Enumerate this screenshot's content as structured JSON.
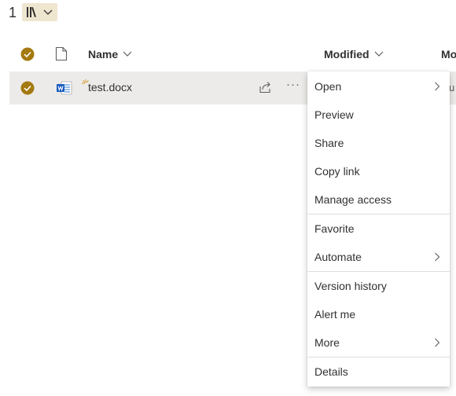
{
  "breadcrumb": {
    "count": "1"
  },
  "icons": {
    "library": "library-icon",
    "dropdown": "chevron-down-icon",
    "check": "check-circle-icon",
    "file": "file-type-icon",
    "word": "word-doc-icon",
    "new": "new-item-icon",
    "share": "share-icon",
    "more": "more-ellipsis-icon",
    "submenu": "chevron-right-icon"
  },
  "colors": {
    "accent": "#a4790f",
    "row_selected": "#edebe9",
    "library_bg": "#efe6cf"
  },
  "columns": {
    "name": "Name",
    "modified": "Modified",
    "modified_by": "Mo"
  },
  "file_row": {
    "name": "test.docx",
    "more": "···",
    "clipped_text": "u"
  },
  "context_menu": {
    "items": [
      {
        "label": "Open",
        "submenu": true
      },
      {
        "label": "Preview"
      },
      {
        "label": "Share"
      },
      {
        "label": "Copy link"
      },
      {
        "label": "Manage access"
      },
      {
        "label": "Favorite"
      },
      {
        "label": "Automate",
        "submenu": true
      },
      {
        "label": "Version history"
      },
      {
        "label": "Alert me"
      },
      {
        "label": "More",
        "submenu": true
      },
      {
        "label": "Details"
      }
    ]
  }
}
